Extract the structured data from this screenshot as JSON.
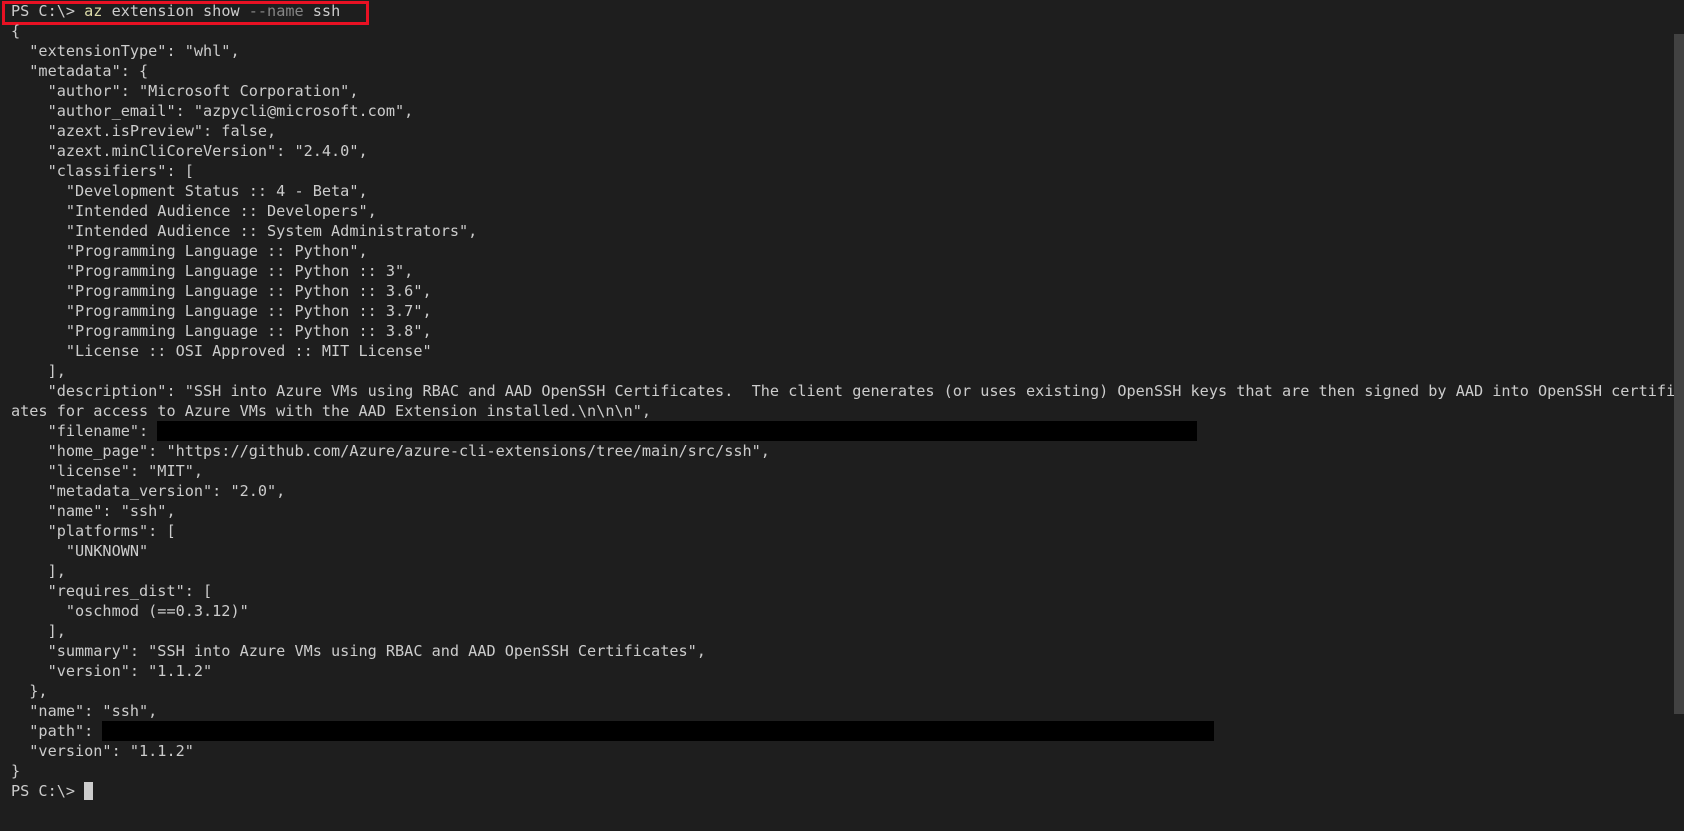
{
  "terminal": {
    "command": {
      "prompt": "PS C:\\> ",
      "exe": "az",
      "args1": " extension show ",
      "flag": "--name",
      "args2": " ssh"
    },
    "lines": [
      "{",
      "  \"extensionType\": \"whl\",",
      "  \"metadata\": {",
      "    \"author\": \"Microsoft Corporation\",",
      "    \"author_email\": \"azpycli@microsoft.com\",",
      "    \"azext.isPreview\": false,",
      "    \"azext.minCliCoreVersion\": \"2.4.0\",",
      "    \"classifiers\": [",
      "      \"Development Status :: 4 - Beta\",",
      "      \"Intended Audience :: Developers\",",
      "      \"Intended Audience :: System Administrators\",",
      "      \"Programming Language :: Python\",",
      "      \"Programming Language :: Python :: 3\",",
      "      \"Programming Language :: Python :: 3.6\",",
      "      \"Programming Language :: Python :: 3.7\",",
      "      \"Programming Language :: Python :: 3.8\",",
      "      \"License :: OSI Approved :: MIT License\"",
      "    ],",
      "    \"description\": \"SSH into Azure VMs using RBAC and AAD OpenSSH Certificates.  The client generates (or uses existing) OpenSSH keys that are then signed by AAD into OpenSSH certific",
      "ates for access to Azure VMs with the AAD Extension installed.\\n\\n\\n\",",
      "    \"filename\": ",
      "    \"home_page\": \"https://github.com/Azure/azure-cli-extensions/tree/main/src/ssh\",",
      "    \"license\": \"MIT\",",
      "    \"metadata_version\": \"2.0\",",
      "    \"name\": \"ssh\",",
      "    \"platforms\": [",
      "      \"UNKNOWN\"",
      "    ],",
      "    \"requires_dist\": [",
      "      \"oschmod (==0.3.12)\"",
      "    ],",
      "    \"summary\": \"SSH into Azure VMs using RBAC and AAD OpenSSH Certificates\",",
      "    \"version\": \"1.1.2\"",
      "  },",
      "  \"name\": \"ssh\",",
      "  \"path\": ",
      "  \"version\": \"1.1.2\"",
      "}"
    ],
    "final_prompt": "PS C:\\> "
  },
  "colors": {
    "background": "#1e1e1e",
    "text": "#cccccc",
    "command_highlight": "#dcdcaa",
    "flag": "#858585",
    "annotation_box": "#e81123",
    "redaction": "#000000"
  }
}
